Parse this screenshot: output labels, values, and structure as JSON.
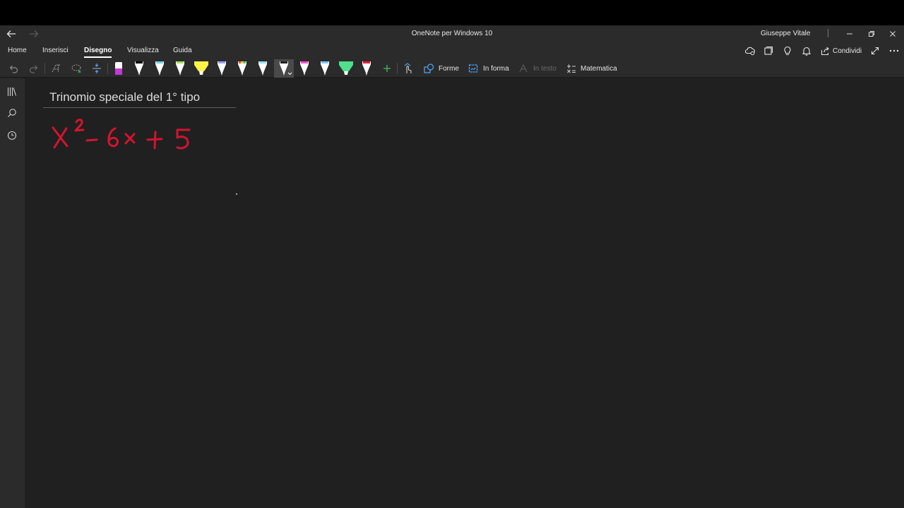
{
  "window": {
    "title": "OneNote per Windows 10",
    "user": "Giuseppe Vitale"
  },
  "ribbon": {
    "tabs": [
      {
        "label": "Home",
        "active": false
      },
      {
        "label": "Inserisci",
        "active": false
      },
      {
        "label": "Disegno",
        "active": true
      },
      {
        "label": "Visualizza",
        "active": false
      },
      {
        "label": "Guida",
        "active": false
      }
    ],
    "share_label": "Condividi"
  },
  "toolbar": {
    "shapes_label": "Forme",
    "to_shape_label": "In forma",
    "to_text_label": "In testo",
    "math_label": "Matematica",
    "pens": [
      {
        "name": "pen-purple-eraser",
        "color": "#c23bd4"
      },
      {
        "name": "pen-black",
        "color": "#000000"
      },
      {
        "name": "pen-cyan",
        "color": "#6fd1ee"
      },
      {
        "name": "pen-green",
        "color": "#a3e05a"
      },
      {
        "name": "highlighter-yellow",
        "color": "#fff34a"
      },
      {
        "name": "pen-galaxy",
        "color": "#9aa0ff"
      },
      {
        "name": "pen-rainbow",
        "color": "#ff9a3a"
      },
      {
        "name": "pen-lightblue",
        "color": "#8fe0ff"
      },
      {
        "name": "pen-white-selected",
        "color": "#ffffff"
      },
      {
        "name": "pen-magenta",
        "color": "#ff4fd8"
      },
      {
        "name": "pen-skyblue",
        "color": "#7ec8ff"
      },
      {
        "name": "highlighter-green",
        "color": "#4fe08a"
      },
      {
        "name": "pen-red",
        "color": "#e8203a"
      }
    ]
  },
  "page": {
    "title": "Trinomio speciale del 1° tipo",
    "ink_text": "x² - 6x + 5",
    "ink_color": "#d4142f"
  }
}
